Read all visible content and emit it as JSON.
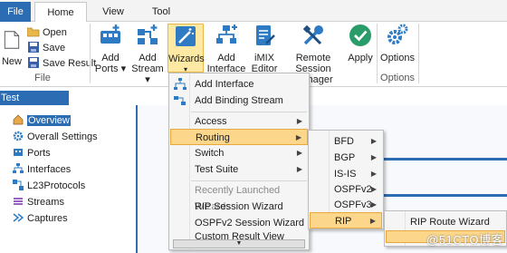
{
  "tabs": {
    "file": "File",
    "home": "Home",
    "view": "View",
    "tool": "Tool"
  },
  "ribbon": {
    "file_group": {
      "new": "New",
      "open": "Open",
      "save": "Save",
      "save_result": "Save Result",
      "label": "File"
    },
    "buttons": {
      "add_ports": [
        "Add",
        "Ports ▾"
      ],
      "add_stream": [
        "Add",
        "Stream ▾"
      ],
      "wizards": [
        "Wizards",
        "▾"
      ],
      "add_interface": [
        "Add",
        "Interface"
      ],
      "imix_editor": [
        "iMIX",
        "Editor"
      ],
      "remote_session_manager": [
        "Remote Session",
        "Manager"
      ],
      "apply": "Apply",
      "options": "Options"
    },
    "options_group_label": "Options"
  },
  "panel": {
    "title": "Test Configuration",
    "items": [
      "Overview",
      "Overall Settings",
      "Ports",
      "Interfaces",
      "L23Protocols",
      "Streams",
      "Captures"
    ]
  },
  "wizards_menu": {
    "items": [
      "Add Interface",
      "Add Binding Stream",
      "Access",
      "Routing",
      "Switch",
      "Test Suite",
      "Recently Launched Wizards",
      "RIP Session Wizard",
      "OSPFv2 Session Wizard",
      "Custom Result View Wizard"
    ]
  },
  "routing_menu": {
    "items": [
      "BFD",
      "BGP",
      "IS-IS",
      "OSPFv2",
      "OSPFv3",
      "RIP"
    ]
  },
  "rip_menu": {
    "items": [
      "RIP Route Wizard"
    ]
  },
  "watermark": "@51CTO博客",
  "colors": {
    "accent": "#2b6cb3",
    "highlight": "#fbd68b",
    "icon_blue": "#2e7bc4"
  }
}
